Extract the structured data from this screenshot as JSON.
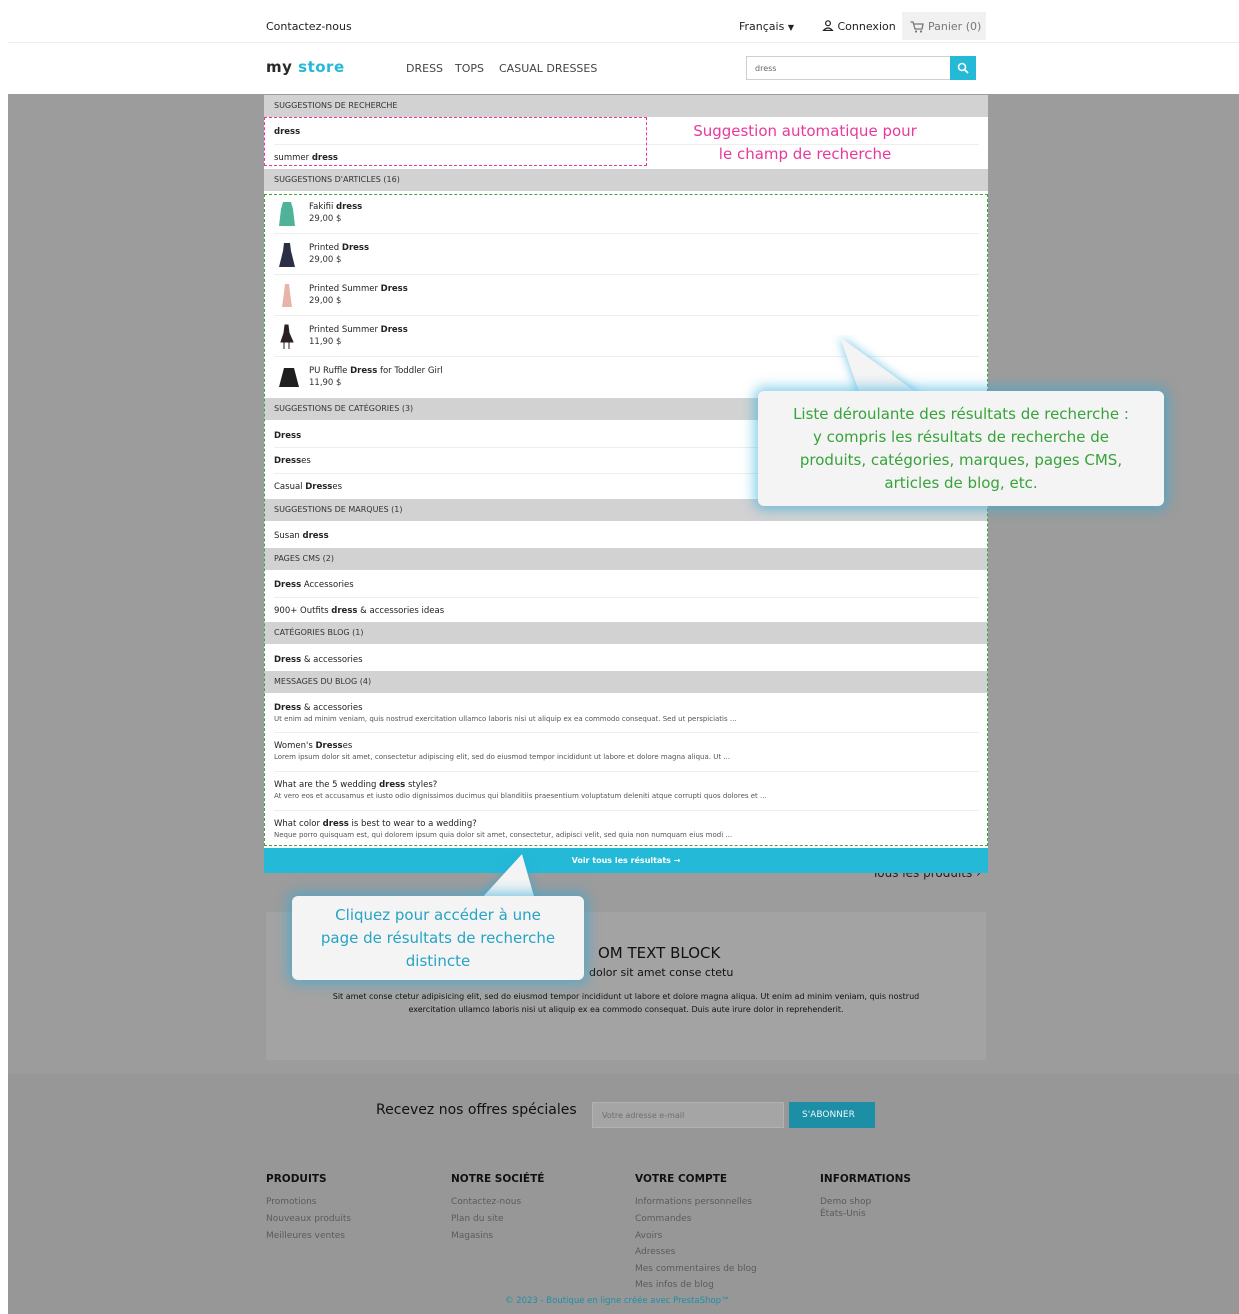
{
  "header": {
    "contact": "Contactez-nous",
    "language": "Français",
    "login": "Connexion",
    "cart": "Panier (0)"
  },
  "logo": {
    "part1": "my",
    "part2": "store"
  },
  "menu": [
    "DRESS",
    "TOPS",
    "CASUAL DRESSES"
  ],
  "search": {
    "value": "dress"
  },
  "dropdown": {
    "search_suggestions_title": "SUGGESTIONS DE RECHERCHE",
    "search_suggestions": [
      {
        "prefix": "",
        "bold": "dress",
        "suffix": ""
      },
      {
        "prefix": "summer ",
        "bold": "dress",
        "suffix": ""
      }
    ],
    "product_title": "SUGGESTIONS D'ARTICLES (16)",
    "products": [
      {
        "prefix": "Fakifii ",
        "bold": "dress",
        "suffix": "",
        "price": "29,00 $",
        "color": "#4fb39a"
      },
      {
        "prefix": "Printed ",
        "bold": "Dress",
        "suffix": "",
        "price": "29,00 $",
        "color": "#2a2f45"
      },
      {
        "prefix": "Printed Summer ",
        "bold": "Dress",
        "suffix": "",
        "price": "29,00 $",
        "color": "#e8b3a8"
      },
      {
        "prefix": "Printed Summer ",
        "bold": "Dress",
        "suffix": "",
        "price": "11,90 $",
        "color": "#2a2020"
      },
      {
        "prefix": "PU Ruffle ",
        "bold": "Dress",
        "suffix": " for Toddler Girl",
        "price": "11,90 $",
        "color": "#1f1f1f"
      }
    ],
    "category_title": "SUGGESTIONS DE CATÉGORIES (3)",
    "categories": [
      {
        "prefix": "",
        "bold": "Dress",
        "suffix": ""
      },
      {
        "prefix": "",
        "bold": "Dress",
        "suffix": "es"
      },
      {
        "prefix": "Casual ",
        "bold": "Dress",
        "suffix": "es"
      }
    ],
    "brand_title": "SUGGESTIONS DE MARQUES (1)",
    "brands": [
      {
        "prefix": "Susan ",
        "bold": "dress",
        "suffix": ""
      }
    ],
    "cms_title": "PAGES CMS (2)",
    "cms": [
      {
        "prefix": "",
        "bold": "Dress",
        "suffix": " Accessories"
      },
      {
        "prefix": "900+ Outfits ",
        "bold": "dress",
        "suffix": " & accessories ideas"
      }
    ],
    "blog_cat_title": "CATÉGORIES BLOG (1)",
    "blog_cats": [
      {
        "prefix": "",
        "bold": "Dress",
        "suffix": " & accessories"
      }
    ],
    "blog_posts_title": "MESSAGES DU BLOG (4)",
    "blog_posts": [
      {
        "prefix": "",
        "bold": "Dress",
        "suffix": " & accessories",
        "excerpt": "Ut enim ad minim veniam, quis nostrud exercitation ullamco laboris nisi ut aliquip ex ea commodo consequat. Sed ut perspiciatis ..."
      },
      {
        "prefix": "Women's ",
        "bold": "Dress",
        "suffix": "es",
        "excerpt": "Lorem ipsum dolor sit amet, consectetur adipiscing elit, sed do eiusmod tempor incididunt ut labore et dolore magna aliqua. Ut ..."
      },
      {
        "prefix": "What are the 5 wedding ",
        "bold": "dress",
        "suffix": " styles?",
        "excerpt": "At vero eos et accusamus et iusto odio dignissimos ducimus qui blanditiis praesentium voluptatum deleniti atque corrupti quos dolores et ..."
      },
      {
        "prefix": "What color ",
        "bold": "dress",
        "suffix": " is best to wear to a wedding?",
        "excerpt": "Neque porro quisquam est, qui dolorem ipsum quia dolor sit amet, consectetur, adipisci velit, sed quia non numquam eius modi ..."
      }
    ],
    "see_all": "Voir tous les résultats →"
  },
  "annotations": {
    "pink_note": [
      "Suggestion automatique pour",
      "le champ de recherche"
    ],
    "green_note": [
      "Liste déroulante des résultats de recherche :",
      "y compris les résultats de recherche de",
      "produits, catégories, marques, pages CMS,",
      "articles de blog, etc."
    ],
    "blue_note": [
      "Cliquez pour accéder à une",
      "page de résultats de recherche",
      "distincte"
    ]
  },
  "all_products_link": "Tous les produits ›",
  "custom_block": {
    "title": "OM TEXT BLOCK",
    "subtitle": "dolor sit amet conse ctetu",
    "text_line1": "Sit amet conse ctetur adipisicing elit, sed do eiusmod tempor incididunt ut labore et dolore magna aliqua. Ut enim ad minim veniam, quis nostrud",
    "text_line2": "exercitation ullamco laboris nisi ut aliquip ex ea commodo consequat. Duis aute irure dolor in reprehenderit."
  },
  "newsletter": {
    "label": "Recevez nos offres spéciales",
    "placeholder": "Votre adresse e-mail",
    "button": "S'ABONNER"
  },
  "footer": {
    "columns": [
      {
        "title": "PRODUITS",
        "links": [
          "Promotions",
          "Nouveaux produits",
          "Meilleures ventes"
        ]
      },
      {
        "title": "NOTRE SOCIÉTÉ",
        "links": [
          "Contactez-nous",
          "Plan du site",
          "Magasins"
        ]
      },
      {
        "title": "VOTRE COMPTE",
        "links": [
          "Informations personnelles",
          "Commandes",
          "Avoirs",
          "Adresses",
          "Mes commentaires de blog",
          "Mes infos de blog"
        ]
      },
      {
        "title": "INFORMATIONS",
        "links": [
          "Demo shop",
          "États-Unis"
        ]
      }
    ],
    "copyright": "© 2023 - Boutique en ligne créée avec PrestaShop™"
  },
  "colors": {
    "accent": "#24b9d7",
    "pink": "#e8399b",
    "green": "#3ca63c"
  }
}
